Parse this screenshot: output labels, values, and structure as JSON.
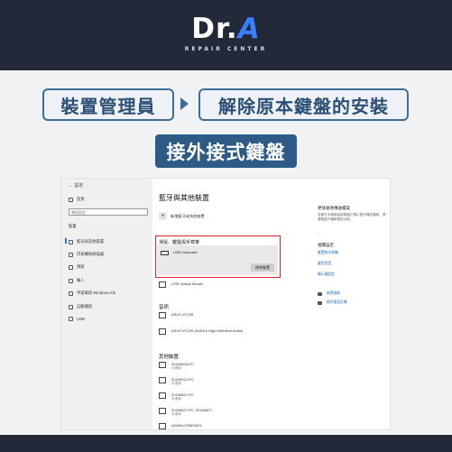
{
  "brand": {
    "logo_main": "Dr.",
    "logo_accent": "A",
    "logo_sub": "REPAIR CENTER"
  },
  "steps": {
    "step1": "裝置管理員",
    "step2": "解除原本鍵盤的安裝"
  },
  "banner": "接外接式鍵盤",
  "settings": {
    "sidebar": {
      "back": "設定",
      "home": "首頁",
      "search_placeholder": "尋找設定",
      "group": "裝置",
      "items": [
        "藍牙與其他裝置",
        "印表機與掃描器",
        "滑鼠",
        "輸入",
        "手寫筆與 Windows Ink",
        "自動播放",
        "USB"
      ]
    },
    "main": {
      "title": "藍牙與其他裝置",
      "add_device": "新增藍牙或其他裝置",
      "kb_section": "滑鼠、鍵盤與手寫筆",
      "kb_device": "USB Keyboard",
      "remove_button": "移除裝置",
      "mouse_device": "USB Optical Mouse",
      "audio_section": "音訊",
      "audio_devices": [
        "ASUS VC239",
        "ASUS VC239 (NVIDIA High Definition Audio)"
      ],
      "other_section": "其他裝置",
      "other_devices": [
        {
          "name": "20160826-PC",
          "status": "未連線"
        },
        {
          "name": "20160912-PC",
          "status": "未連線"
        },
        {
          "name": "20166827-PC",
          "status": "未連線"
        },
        {
          "name": "20166827-PC: 20160827:",
          "status": "未連線"
        },
        {
          "name": "ADMIN-3TBE0DF1",
          "status": ""
        }
      ]
    },
    "right": {
      "fast_title": "更快速地傳送檔案",
      "fast_text": "若要在手機與這部電腦之間以藍牙傳送檔案，請選取藍牙檔案傳送功能。",
      "related_title": "相關設定",
      "related_links": [
        "裝置和印表機",
        "聲音設定",
        "顯示器設定"
      ],
      "links": [
        "取得協助",
        "提供意見反應"
      ]
    }
  }
}
